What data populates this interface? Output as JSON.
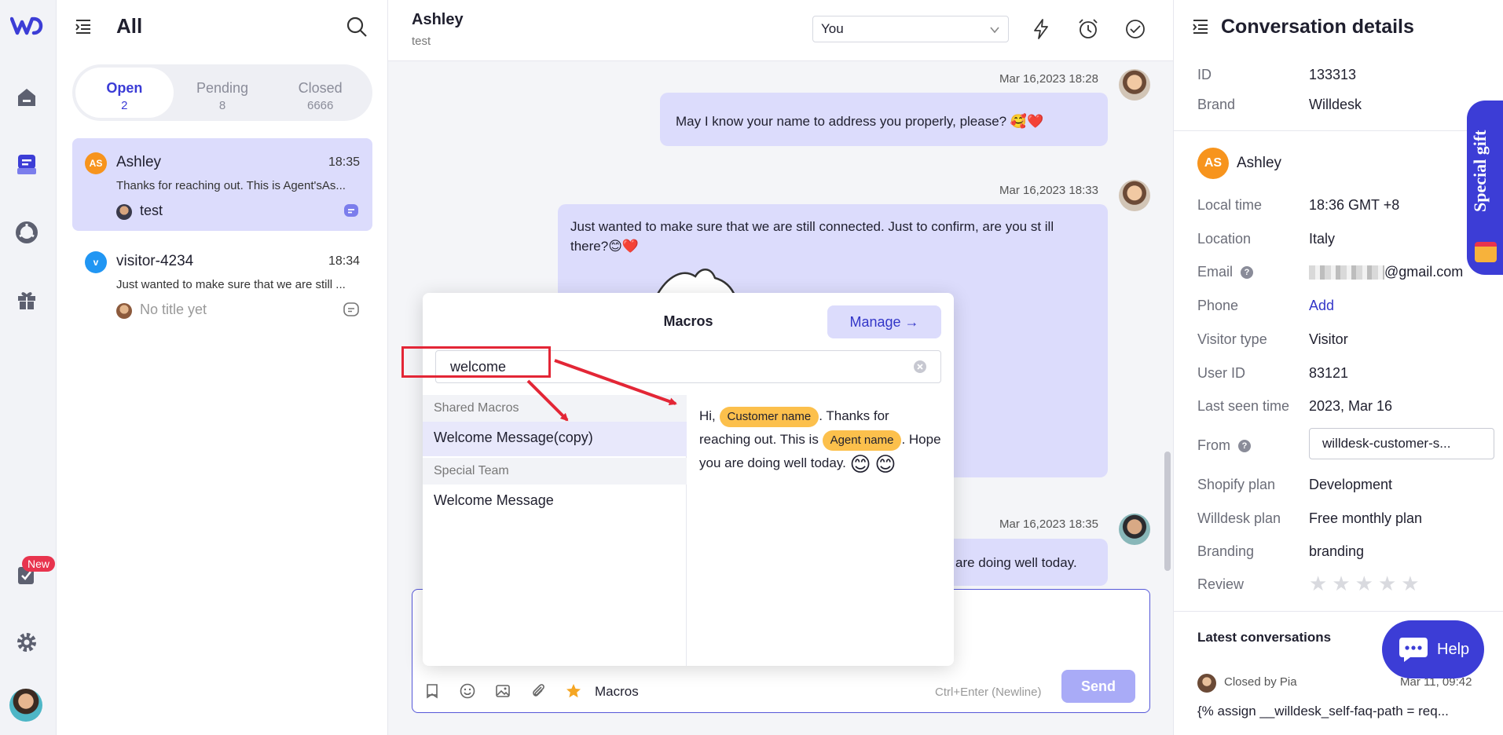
{
  "rail": {
    "new_badge": "New"
  },
  "list": {
    "title": "All",
    "tabs": [
      {
        "label": "Open",
        "count": "2"
      },
      {
        "label": "Pending",
        "count": "8"
      },
      {
        "label": "Closed",
        "count": "6666"
      }
    ],
    "conversations": [
      {
        "initials": "AS",
        "name": "Ashley",
        "time": "18:35",
        "snippet": "Thanks for reaching out. This is Agent'sAs...",
        "subtitle": "test",
        "avatar_color": "#f7941d"
      },
      {
        "initials": "v",
        "name": "visitor-4234",
        "time": "18:34",
        "snippet": "Just wanted to make sure that we are still ...",
        "subtitle": "No title yet",
        "avatar_color": "#2196f3"
      }
    ]
  },
  "chat": {
    "name": "Ashley",
    "subtitle": "test",
    "assignee": "You",
    "messages": [
      {
        "time": "Mar 16,2023 18:28",
        "text": "May I know your name to address you properly, please? 🥰❤️"
      },
      {
        "time": "Mar 16,2023 18:33",
        "text": "Just wanted to make sure that we are still connected. Just to confirm, are you st ill there?😊❤️"
      },
      {
        "time": "Mar 16,2023 18:35",
        "text": "are doing well today."
      }
    ],
    "composer": {
      "macros_label": "Macros",
      "hint": "Ctrl+Enter (Newline)",
      "send_label": "Send"
    }
  },
  "macros": {
    "title": "Macros",
    "manage_label": "Manage →",
    "search_value": "welcome",
    "groups": [
      {
        "name": "Shared Macros",
        "items": [
          "Welcome Message(copy)"
        ]
      },
      {
        "name": "Special Team",
        "items": [
          "Welcome Message"
        ]
      }
    ],
    "preview": {
      "part1": "Hi,",
      "tag_customer": "Customer name",
      "part2": ". Thanks for reaching out. This is",
      "tag_agent": "Agent name",
      "part3": ". Hope you are doing well today.",
      "emoji": "😊"
    }
  },
  "details": {
    "title": "Conversation details",
    "id_label": "ID",
    "id_value": "133313",
    "brand_label": "Brand",
    "brand_value": "Willdesk",
    "customer_initials": "AS",
    "customer_name": "Ashley",
    "rows": [
      {
        "label": "Local time",
        "value": "18:36 GMT +8"
      },
      {
        "label": "Location",
        "value": "Italy"
      },
      {
        "label": "Email",
        "value": "@gmail.com"
      },
      {
        "label": "Phone",
        "value": "Add"
      },
      {
        "label": "Visitor type",
        "value": "Visitor"
      },
      {
        "label": "User ID",
        "value": "83121"
      },
      {
        "label": "Last seen time",
        "value": "2023, Mar 16"
      },
      {
        "label": "From",
        "value": "willdesk-customer-s..."
      },
      {
        "label": "Shopify plan",
        "value": "Development"
      },
      {
        "label": "Willdesk plan",
        "value": "Free monthly plan"
      },
      {
        "label": "Branding",
        "value": "branding"
      },
      {
        "label": "Review",
        "value": ""
      }
    ],
    "latest_title": "Latest conversations",
    "latest": {
      "closed_by": "Closed by Pia",
      "time": "Mar 11, 09:42",
      "snippet": "{% assign __willdesk_self-faq-path = req..."
    }
  },
  "gift_label": "Special gift",
  "help_label": "Help",
  "colors": {
    "accent": "#3c3dd6",
    "bubble": "#dcdcfc",
    "tag": "#fcc04c",
    "annotation": "#e32636"
  }
}
